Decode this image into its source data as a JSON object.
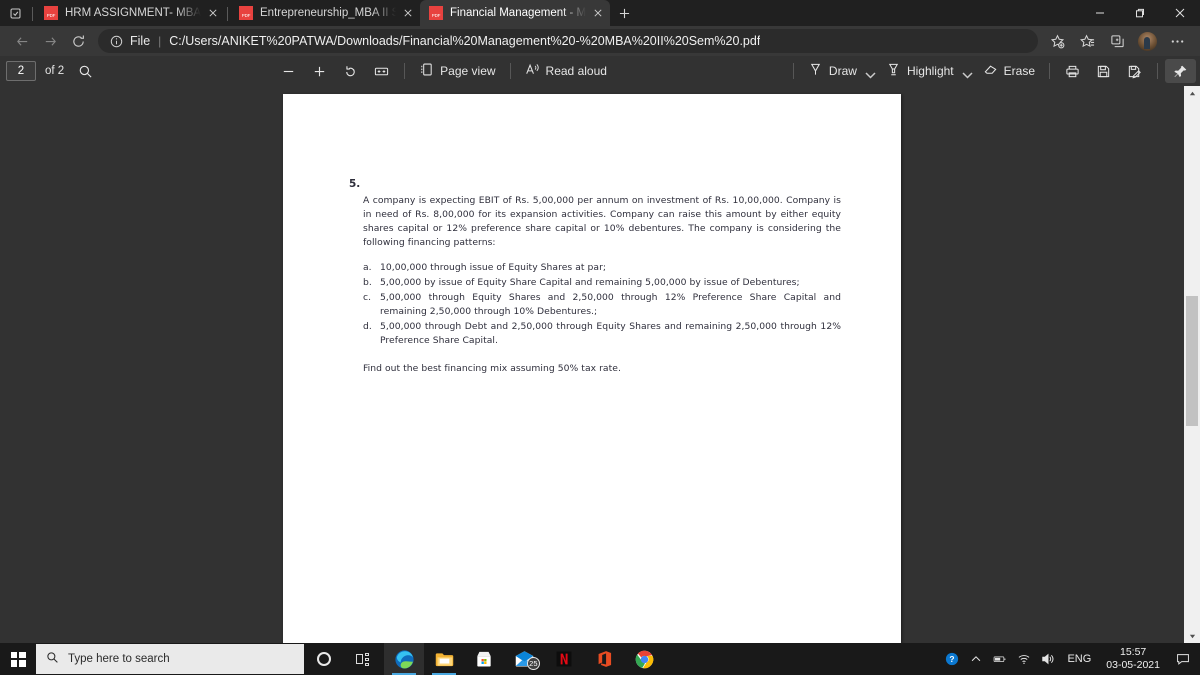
{
  "browser": {
    "tab_search_icon": "tab-search-icon",
    "new_tab_label": "+",
    "tabs": [
      {
        "title": "HRM ASSIGNMENT- MBA II SEM",
        "favicon": "pdf-file-icon",
        "active": false
      },
      {
        "title": "Entrepreneurship_MBA II Sem.pdf",
        "favicon": "pdf-file-icon",
        "active": false
      },
      {
        "title": "Financial Management - MBA II Sem",
        "favicon": "pdf-file-icon",
        "active": true
      }
    ],
    "window_controls": {
      "minimize": "minimize-icon",
      "maximize": "restore-icon",
      "close": "close-icon"
    },
    "nav": {
      "back": "back-arrow-icon",
      "forward": "forward-arrow-icon",
      "refresh": "refresh-icon"
    },
    "omnibox": {
      "info_icon": "info-circle-icon",
      "scheme_label": "File",
      "url": "C:/Users/ANIKET%20PATWA/Downloads/Financial%20Management%20-%20MBA%20II%20Sem%20.pdf"
    },
    "address_icons": [
      {
        "name": "add-favorite-icon",
        "label": "Add this page to favorites"
      },
      {
        "name": "favorites-icon",
        "label": "Favorites"
      },
      {
        "name": "collections-icon",
        "label": "Collections"
      },
      {
        "name": "profile-avatar",
        "label": "Profile"
      },
      {
        "name": "settings-and-more-icon",
        "label": "Settings and more"
      }
    ]
  },
  "pdf_toolbar": {
    "page_number": "2",
    "page_count_label": "of 2",
    "search_icon": "search-icon",
    "zoom_out_icon": "zoom-out-icon",
    "zoom_in_icon": "zoom-in-icon",
    "rotate_icon": "rotate-icon",
    "fit_page_icon": "fit-to-width-icon",
    "page_view_label": "Page view",
    "page_view_icon": "page-view-icon",
    "read_aloud_label": "Read aloud",
    "read_aloud_icon": "read-aloud-icon",
    "draw_label": "Draw",
    "draw_icon": "pen-icon",
    "highlight_label": "Highlight",
    "highlight_icon": "highlighter-icon",
    "erase_label": "Erase",
    "erase_icon": "eraser-icon",
    "print_icon": "print-icon",
    "save_icon": "save-icon",
    "save_as_icon": "save-as-icon",
    "pin_icon": "pin-toolbar-icon"
  },
  "document": {
    "question_number": "5.",
    "intro": "A company is expecting EBIT of Rs. 5,00,000 per annum on investment of Rs. 10,00,000. Company is in need of Rs. 8,00,000 for its expansion activities. Company can raise this amount by either equity shares capital or 12% preference share capital or 10% debentures. The company is considering the following financing patterns:",
    "options": [
      {
        "marker": "a.",
        "text": "10,00,000 through  issue of Equity Shares at par;"
      },
      {
        "marker": "b.",
        "text": "5,00,000 by issue of Equity Share Capital and remaining 5,00,000 by issue of Debentures;"
      },
      {
        "marker": "c.",
        "text": "5,00,000 through Equity Shares and 2,50,000 through 12% Preference Share Capital and remaining 2,50,000 through 10% Debentures.;"
      },
      {
        "marker": "d.",
        "text": "5,00,000 through Debt and 2,50,000 through Equity Shares and remaining 2,50,000 through 12% Preference Share Capital."
      }
    ],
    "footer": "Find out the best financing mix assuming 50% tax rate."
  },
  "taskbar": {
    "start_icon": "windows-start-icon",
    "search_placeholder": "Type here to search",
    "search_icon": "search-icon",
    "cortana_icon": "cortana-icon",
    "task_view_icon": "task-view-icon",
    "apps": [
      {
        "name": "microsoft-edge-icon",
        "label": "Microsoft Edge",
        "active": true
      },
      {
        "name": "file-explorer-icon",
        "label": "File Explorer",
        "active": false
      },
      {
        "name": "microsoft-store-icon",
        "label": "Microsoft Store",
        "active": false
      },
      {
        "name": "mail-icon",
        "label": "Mail",
        "badge": "25",
        "active": false
      },
      {
        "name": "netflix-icon",
        "label": "Netflix",
        "active": false
      },
      {
        "name": "microsoft-office-icon",
        "label": "Office",
        "active": false
      },
      {
        "name": "google-chrome-icon",
        "label": "Google Chrome",
        "active": false
      }
    ],
    "tray": {
      "help_icon": "help-circle-icon",
      "show_hidden_icon": "chevron-up-icon",
      "battery_icon": "battery-icon",
      "network_icon": "wifi-icon",
      "volume_icon": "volume-icon",
      "language": "ENG",
      "time": "15:57",
      "date": "03-05-2021",
      "action_center_icon": "action-center-icon"
    }
  }
}
